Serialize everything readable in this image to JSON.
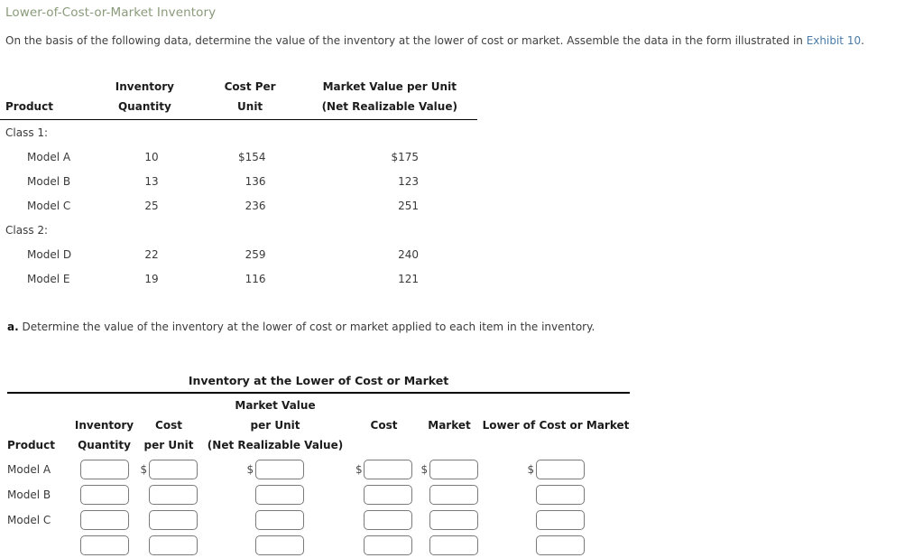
{
  "page": {
    "title": "Lower-of-Cost-or-Market Inventory",
    "intro_before": "On the basis of the following data, determine the value of the inventory at the lower of cost or market. Assemble the data in the form illustrated in ",
    "intro_link": "Exhibit 10",
    "intro_after": ".",
    "link_color": "#4a7ba7",
    "title_color": "#8a9a7b"
  },
  "data_table": {
    "headers": {
      "product": "Product",
      "quantity_line1": "Inventory",
      "quantity_line2": "Quantity",
      "cost_line1": "Cost Per",
      "cost_line2": "Unit",
      "market_line1": "Market Value per Unit",
      "market_line2": "(Net Realizable Value)"
    },
    "rows": [
      {
        "type": "group",
        "label": "Class 1:",
        "quantity": "",
        "cost": "",
        "market": ""
      },
      {
        "type": "item",
        "label": "Model A",
        "quantity": "10",
        "cost": "$154",
        "market": "$175"
      },
      {
        "type": "item",
        "label": "Model B",
        "quantity": "13",
        "cost": "136",
        "market": "123"
      },
      {
        "type": "item",
        "label": "Model C",
        "quantity": "25",
        "cost": "236",
        "market": "251"
      },
      {
        "type": "group",
        "label": "Class 2:",
        "quantity": "",
        "cost": "",
        "market": ""
      },
      {
        "type": "item",
        "label": "Model D",
        "quantity": "22",
        "cost": "259",
        "market": "240"
      },
      {
        "type": "item",
        "label": "Model E",
        "quantity": "19",
        "cost": "116",
        "market": "121"
      }
    ]
  },
  "requirement": {
    "marker": "a.",
    "text": " Determine the value of the inventory at the lower of cost or market applied to each item in the inventory."
  },
  "form": {
    "title": "Inventory at the Lower of Cost or Market",
    "headers": {
      "product": "Product",
      "quantity_line1": "Inventory",
      "quantity_line2": "Quantity",
      "cost_per_unit_line1": "Cost",
      "cost_per_unit_line2": "per Unit",
      "market_value_line1": "Market Value",
      "market_value_line2": "per Unit",
      "market_value_line3": "(Net Realizable Value)",
      "cost": "Cost",
      "market": "Market",
      "lower_of_cost_or_market": "Lower of Cost or Market"
    },
    "currency_symbol": "$",
    "rows": [
      {
        "label": "Model A",
        "show_dollar": true,
        "quantity": "",
        "cost_per_unit": "",
        "market_value": "",
        "cost": "",
        "market": "",
        "lcm": ""
      },
      {
        "label": "Model B",
        "show_dollar": false,
        "quantity": "",
        "cost_per_unit": "",
        "market_value": "",
        "cost": "",
        "market": "",
        "lcm": ""
      },
      {
        "label": "Model C",
        "show_dollar": false,
        "quantity": "",
        "cost_per_unit": "",
        "market_value": "",
        "cost": "",
        "market": "",
        "lcm": ""
      },
      {
        "label": "",
        "show_dollar": false,
        "quantity": "",
        "cost_per_unit": "",
        "market_value": "",
        "cost": "",
        "market": "",
        "lcm": ""
      }
    ]
  }
}
